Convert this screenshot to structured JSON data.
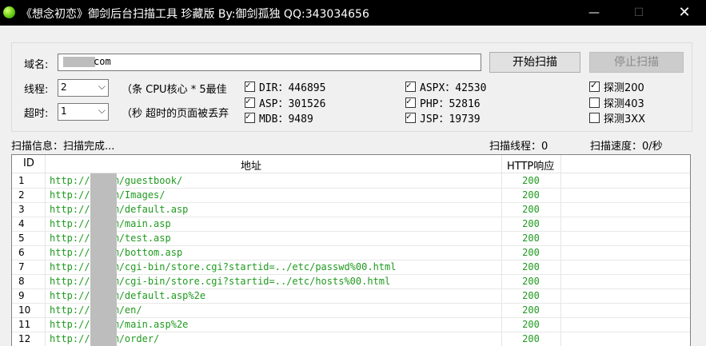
{
  "window": {
    "title": "《想念初恋》御剑后台扫描工具 珍藏版 By:御剑孤独 QQ:343034656",
    "minimize_glyph": "—",
    "maximize_glyph": "☐",
    "close_glyph": "✕"
  },
  "form": {
    "domain_label": "域名:",
    "domain_value": "com",
    "start_button": "开始扫描",
    "stop_button": "停止扫描",
    "threads_label": "线程:",
    "threads_value": "2",
    "threads_hint": "（条 CPU核心 * 5最佳",
    "timeout_label": "超时:",
    "timeout_value": "1",
    "timeout_hint": "（秒 超时的页面被丢弃"
  },
  "dictionaries": [
    {
      "label": "DIR：446895",
      "checked": true
    },
    {
      "label": "ASP：301526",
      "checked": true
    },
    {
      "label": "MDB：9489",
      "checked": true
    },
    {
      "label": "ASPX：42530",
      "checked": true
    },
    {
      "label": "PHP：52816",
      "checked": true
    },
    {
      "label": "JSP：19739",
      "checked": true
    }
  ],
  "probes": [
    {
      "label": "探测200",
      "checked": true
    },
    {
      "label": "探测403",
      "checked": false
    },
    {
      "label": "探测3XX",
      "checked": false
    }
  ],
  "status": {
    "scan_info": "扫描信息：扫描完成...",
    "scan_threads": "扫描线程：0",
    "scan_speed": "扫描速度：0/秒"
  },
  "table": {
    "columns": [
      "ID",
      "地址",
      "HTTP响应"
    ],
    "rows": [
      {
        "id": "1",
        "url": "http://      .com/guestbook/",
        "code": "200"
      },
      {
        "id": "2",
        "url": "http://      .com/Images/",
        "code": "200"
      },
      {
        "id": "3",
        "url": "http://      .com/default.asp",
        "code": "200"
      },
      {
        "id": "4",
        "url": "http://      .com/main.asp",
        "code": "200"
      },
      {
        "id": "5",
        "url": "http://      .com/test.asp",
        "code": "200"
      },
      {
        "id": "6",
        "url": "http://      .com/bottom.asp",
        "code": "200"
      },
      {
        "id": "7",
        "url": "http://      .com/cgi-bin/store.cgi?startid=../etc/passwd%00.html",
        "code": "200"
      },
      {
        "id": "8",
        "url": "http://      .com/cgi-bin/store.cgi?startid=../etc/hosts%00.html",
        "code": "200"
      },
      {
        "id": "9",
        "url": "http://      .com/default.asp%2e",
        "code": "200"
      },
      {
        "id": "10",
        "url": "http://      .com/en/",
        "code": "200"
      },
      {
        "id": "11",
        "url": "http://      .com/main.asp%2e",
        "code": "200"
      },
      {
        "id": "12",
        "url": "http://      .com/order/",
        "code": "200"
      }
    ]
  },
  "colors": {
    "url_text": "#1f9a1f",
    "titlebar": "#000000"
  },
  "icons": {
    "app": "green-ball-icon",
    "combo_arrow": "chevron-down-icon",
    "check": "check-icon"
  }
}
